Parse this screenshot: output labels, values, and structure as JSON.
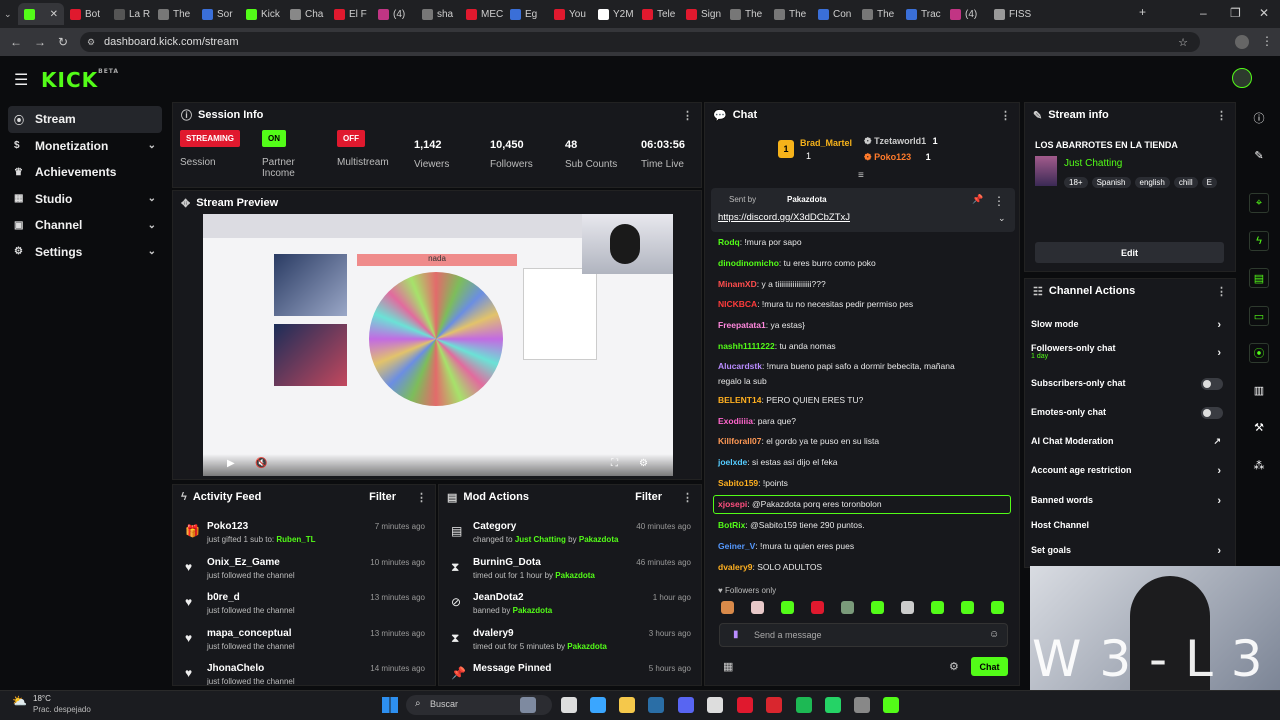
{
  "browser": {
    "tabs": [
      "Bot",
      "La R",
      "The",
      "Sor",
      "Kick",
      "Cha",
      "El F",
      "(4)",
      "sha",
      "MEC",
      "Eg",
      "You",
      "Y2M",
      "Tele",
      "Sign",
      "The",
      "The",
      "Con",
      "The",
      "Trac",
      "(4)",
      "FISS"
    ],
    "url": "dashboard.kick.com/stream"
  },
  "app": {
    "logo": "KICK",
    "logo_sup": "BETA"
  },
  "sidebar": {
    "items": [
      {
        "label": "Stream",
        "icon": "stream-icon"
      },
      {
        "label": "Monetization",
        "icon": "dollar-icon"
      },
      {
        "label": "Achievements",
        "icon": "trophy-icon"
      },
      {
        "label": "Studio",
        "icon": "film-icon"
      },
      {
        "label": "Channel",
        "icon": "channel-icon"
      },
      {
        "label": "Settings",
        "icon": "gear-icon"
      }
    ]
  },
  "session": {
    "title": "Session Info",
    "streaming": "STREAMING",
    "session_label": "Session",
    "partner_badge": "ON",
    "partner_label": "Partner Income",
    "multistream_badge": "OFF",
    "multistream_label": "Multistream",
    "viewers": "1,142",
    "viewers_label": "Viewers",
    "followers": "10,450",
    "followers_label": "Followers",
    "subs": "48",
    "subs_label": "Sub Counts",
    "time": "06:03:56",
    "time_label": "Time Live"
  },
  "preview": {
    "title": "Stream Preview",
    "wheel_title": "nada"
  },
  "activity": {
    "title": "Activity Feed",
    "filter": "Filter",
    "rows": [
      {
        "name": "Poko123",
        "sub": "just gifted 1 sub to:",
        "target": "Ruben_TL",
        "time": "7 minutes ago",
        "icon": "gift-icon"
      },
      {
        "name": "Onix_Ez_Game",
        "sub": "just followed the channel",
        "target": "",
        "time": "10 minutes ago",
        "icon": "heart-icon"
      },
      {
        "name": "b0re_d",
        "sub": "just followed the channel",
        "target": "",
        "time": "13 minutes ago",
        "icon": "heart-icon"
      },
      {
        "name": "mapa_conceptual",
        "sub": "just followed the channel",
        "target": "",
        "time": "13 minutes ago",
        "icon": "heart-icon"
      },
      {
        "name": "JhonaChelo",
        "sub": "just followed the channel",
        "target": "",
        "time": "14 minutes ago",
        "icon": "heart-icon"
      }
    ]
  },
  "mod": {
    "title": "Mod Actions",
    "filter": "Filter",
    "rows": [
      {
        "name": "Category",
        "sub": "changed to",
        "mid": "Just Chatting",
        "by": "by",
        "who": "Pakazdota",
        "time": "40 minutes ago",
        "icon": "category-icon"
      },
      {
        "name": "BurninG_Dota",
        "sub": "timed out for 1 hour by",
        "mid": "",
        "by": "",
        "who": "Pakazdota",
        "time": "46 minutes ago",
        "icon": "hourglass-icon"
      },
      {
        "name": "JeanDota2",
        "sub": "banned by",
        "mid": "",
        "by": "",
        "who": "Pakazdota",
        "time": "1 hour ago",
        "icon": "ban-icon"
      },
      {
        "name": "dvalery9",
        "sub": "timed out for 5 minutes by",
        "mid": "",
        "by": "",
        "who": "Pakazdota",
        "time": "3 hours ago",
        "icon": "hourglass-icon"
      },
      {
        "name": "Message Pinned",
        "sub": "",
        "mid": "",
        "by": "",
        "who": "",
        "time": "5 hours ago",
        "icon": "pin-icon"
      }
    ]
  },
  "chat": {
    "title": "Chat",
    "top_gifters": [
      {
        "name": "Brad_Martel",
        "count": "1",
        "rank": "1"
      },
      {
        "name": "Tzetaworld1",
        "count": "1"
      },
      {
        "name": "Poko123",
        "count": "1"
      }
    ],
    "pinned_by_label": "Sent by",
    "pinned_by": "Pakazdota",
    "pinned_link": "https://discord.gg/X3dDCbZTxJ",
    "messages": [
      {
        "user": "Rodq",
        "color": "#53fc18",
        "text": ": !mura por sapo"
      },
      {
        "user": "dinodinomicho",
        "color": "#53fc18",
        "text": ": tu eres burro como poko"
      },
      {
        "user": "MinamXD",
        "color": "#ff4d4d",
        "text": ": y a tiiiiiiiiiiiiiiiiii???"
      },
      {
        "user": "NICKBCA",
        "color": "#ff3b3b",
        "text": ": !mura tu no necesitas pedir permiso pes"
      },
      {
        "user": "Freepatata1",
        "color": "#ff88dd",
        "text": ": ya estas}"
      },
      {
        "user": "nashh1111222",
        "color": "#53fc18",
        "text": ": tu anda nomas"
      },
      {
        "user": "Alucardstk",
        "color": "#b98cff",
        "text": ": !mura bueno papi safo a dormir bebecita, mañana"
      },
      {
        "user": "",
        "color": "#e8e8e8",
        "text": "regalo la sub"
      },
      {
        "user": "BELENT14",
        "color": "#ffb020",
        "text": ": PERO QUIEN ERES TU?"
      },
      {
        "user": "Exodiiiia",
        "color": "#ff66cc",
        "text": ": para que?"
      },
      {
        "user": "Killforall07",
        "color": "#ff9955",
        "text": ": el gordo ya te puso en su lista"
      },
      {
        "user": "joelxde",
        "color": "#55ccff",
        "text": ": si estas así dijo el feka"
      },
      {
        "user": "Sabito159",
        "color": "#ffb020",
        "text": ": !points"
      },
      {
        "user": "xjosepi",
        "color": "#ff4f7f",
        "text": ": @Pakazdota porq eres toronbolon"
      },
      {
        "user": "BotRix",
        "color": "#53fc18",
        "text": ": @Sabito159 tiene 290 puntos."
      },
      {
        "user": "Geiner_V",
        "color": "#5599ff",
        "text": ": !mura tu quien eres pues"
      },
      {
        "user": "dvalery9",
        "color": "#ffb020",
        "text": ": SOLO ADULTOS"
      }
    ],
    "followers_only": "Followers only",
    "placeholder": "Send a message",
    "send": "Chat"
  },
  "stream_info": {
    "title": "Stream info",
    "stream_title": "LOS ABARROTES EN LA TIENDA",
    "category": "Just Chatting",
    "tags": [
      "18+",
      "Spanish",
      "english",
      "chill",
      "E"
    ],
    "edit": "Edit"
  },
  "channel_actions": {
    "title": "Channel Actions",
    "items": [
      {
        "label": "Slow mode",
        "sub": "",
        "control": "chevron"
      },
      {
        "label": "Followers-only chat",
        "sub": "1 day",
        "control": "chevron"
      },
      {
        "label": "Subscribers-only chat",
        "sub": "",
        "control": "toggle"
      },
      {
        "label": "Emotes-only chat",
        "sub": "",
        "control": "toggle"
      },
      {
        "label": "AI Chat Moderation",
        "sub": "",
        "control": "external"
      },
      {
        "label": "Account age restriction",
        "sub": "",
        "control": "chevron"
      },
      {
        "label": "Banned words",
        "sub": "",
        "control": "chevron"
      },
      {
        "label": "Host Channel",
        "sub": "",
        "control": "none"
      },
      {
        "label": "Set goals",
        "sub": "",
        "control": "chevron"
      }
    ]
  },
  "webcam_overlay": "W 3 - L 3",
  "taskbar": {
    "temp": "18°C",
    "weather": "Prac. despejado",
    "search": "Buscar"
  },
  "colors": {
    "accent": "#53fc18",
    "bg": "#0b0c0e",
    "panel": "#17181c",
    "red": "#e0192e"
  }
}
